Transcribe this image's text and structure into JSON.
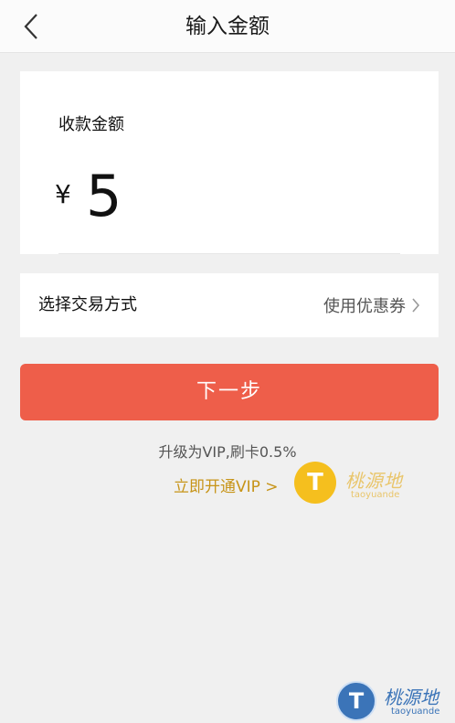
{
  "header": {
    "title": "输入金额"
  },
  "amount_card": {
    "label": "收款金额",
    "currency": "¥",
    "amount": "5"
  },
  "method_row": {
    "label": "选择交易方式",
    "coupon": "使用优惠券"
  },
  "next_button": {
    "label": "下一步"
  },
  "hint": {
    "text": "升级为VIP,刷卡0.5%"
  },
  "vip_link": {
    "text": "立即开通VIP >"
  },
  "watermark": {
    "logo_letter": "T",
    "name": "桃源地",
    "domain": "taoyuande"
  },
  "colors": {
    "accent": "#ee5e4a",
    "vip": "#c79418"
  }
}
